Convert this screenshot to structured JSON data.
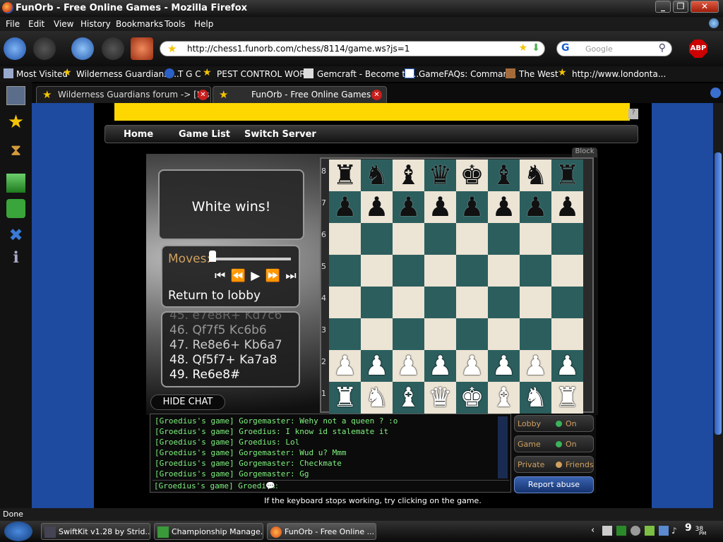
{
  "window": {
    "title": "FunOrb - Free Online Games - Mozilla Firefox",
    "min": "_",
    "max": "❐",
    "close": "✕"
  },
  "menu": [
    "File",
    "Edit",
    "View",
    "History",
    "Bookmarks",
    "Tools",
    "Help"
  ],
  "address": {
    "url": "http://chess1.funorb.com/chess/8114/game.ws?js=1"
  },
  "search": {
    "engine": "G",
    "placeholder": "Google"
  },
  "adblock": "ABP",
  "bookmarks": [
    "Most Visited",
    "Wilderness Guardians ...",
    "T G C",
    "PEST CONTROL WOR...",
    "Gemcraft - Become th...",
    "GameFAQs: Comman...",
    "The West",
    "http://www.londonta..."
  ],
  "tabs": [
    {
      "label": "Wilderness Guardians forum -> [It's O...",
      "active": false
    },
    {
      "label": "FunOrb - Free Online Games",
      "active": true
    }
  ],
  "site_nav": {
    "home": "Home",
    "game_list": "Game List",
    "switch_server": "Switch Server"
  },
  "ad_button": "?",
  "game": {
    "result": "White wins!",
    "moves_label": "Moves:",
    "controls": "⏮ ⏪ ▶ ⏩ ⏭",
    "return_label": "Return to lobby",
    "block_label": "Block",
    "move_list": [
      "45. e7e8R+ Kd7c6",
      "46. Qf7f5 Kc6b6",
      "47. Re8e6+ Kb6a7",
      "48. Qf5f7+ Ka7a8",
      "49. Re6e8#"
    ],
    "hide_chat": "HIDE CHAT",
    "ranks": [
      "8",
      "7",
      "6",
      "5",
      "4",
      "3",
      "2",
      "1"
    ]
  },
  "board": {
    "light_color": "#ece4d4",
    "dark_color": "#2c5e5e",
    "rows": [
      [
        "bR",
        "bN",
        "bB",
        "bQ",
        "bK",
        "bB",
        "bN",
        "bR"
      ],
      [
        "bP",
        "bP",
        "bP",
        "bP",
        "bP",
        "bP",
        "bP",
        "bP"
      ],
      [
        "",
        "",
        "",
        "",
        "",
        "",
        "",
        ""
      ],
      [
        "",
        "",
        "",
        "",
        "",
        "",
        "",
        ""
      ],
      [
        "",
        "",
        "",
        "",
        "",
        "",
        "",
        ""
      ],
      [
        "",
        "",
        "",
        "",
        "",
        "",
        "",
        ""
      ],
      [
        "wP",
        "wP",
        "wP",
        "wP",
        "wP",
        "wP",
        "wP",
        "wP"
      ],
      [
        "wR",
        "wN",
        "wB",
        "wQ",
        "wK",
        "wB",
        "wN",
        "wR"
      ]
    ]
  },
  "chat": {
    "lines": [
      "[Groedius's game] Gorgemaster: Wehy not a queen ? :o",
      "[Groedius's game] Groedius: I know id stalemate it",
      "[Groedius's game] Groedius: Lol",
      "[Groedius's game] Gorgemaster: Wud u? Mmm",
      "[Groedius's game] Gorgemaster: Checkmate",
      "[Groedius's game] Gorgemaster: Gg"
    ],
    "input_prefix": "[Groedius's game] Groedius",
    "input_suffix": ":"
  },
  "side_buttons": [
    {
      "label": "Lobby",
      "value": "On",
      "indicator": "green"
    },
    {
      "label": "Game",
      "value": "On",
      "indicator": "green"
    },
    {
      "label": "Private",
      "value": "Friends",
      "indicator": "smile"
    }
  ],
  "report_abuse": "Report abuse",
  "hint": "If the keyboard stops working, try clicking on the game.",
  "status": "Done",
  "taskbar": [
    "SwiftKit v1.28 by Strid...",
    "Championship Manage...",
    "FunOrb - Free Online ..."
  ],
  "clock": {
    "time": "9",
    "minutes": "38",
    "ampm": "PM"
  }
}
